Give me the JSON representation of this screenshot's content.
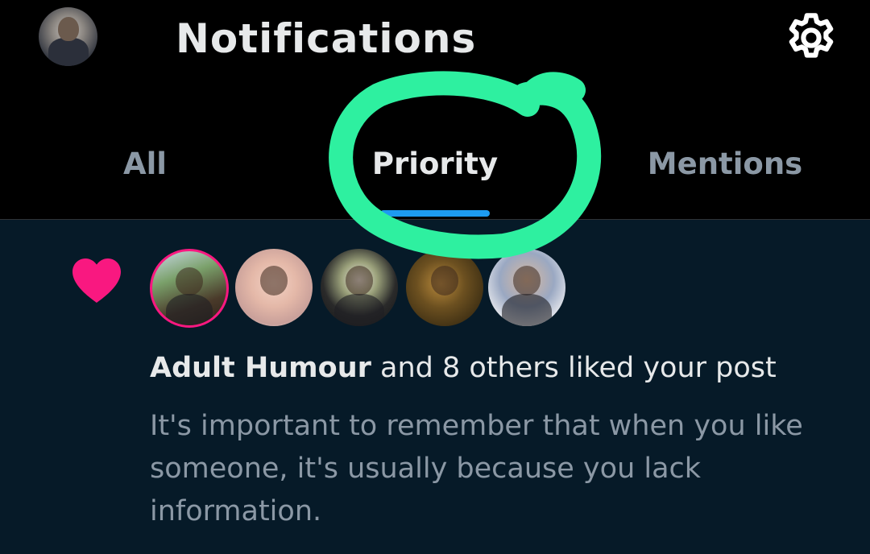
{
  "header": {
    "title": "Notifications",
    "avatar_icon": "profile-avatar",
    "settings_icon": "gear-icon"
  },
  "tabs": [
    {
      "label": "All",
      "active": false
    },
    {
      "label": "Priority",
      "active": true
    },
    {
      "label": "Mentions",
      "active": false
    }
  ],
  "notification": {
    "icon": "heart-icon",
    "actor": "Adult Humour",
    "action": " and 8 others liked your post",
    "post_excerpt": "It's important to remember that when you like someone, it's usually because you lack information.",
    "avatar_count_shown": 5
  },
  "colors": {
    "accent": "#1d9bf0",
    "heart": "#f91880",
    "annotation": "#2ef0a0",
    "background_content": "#061a28"
  }
}
